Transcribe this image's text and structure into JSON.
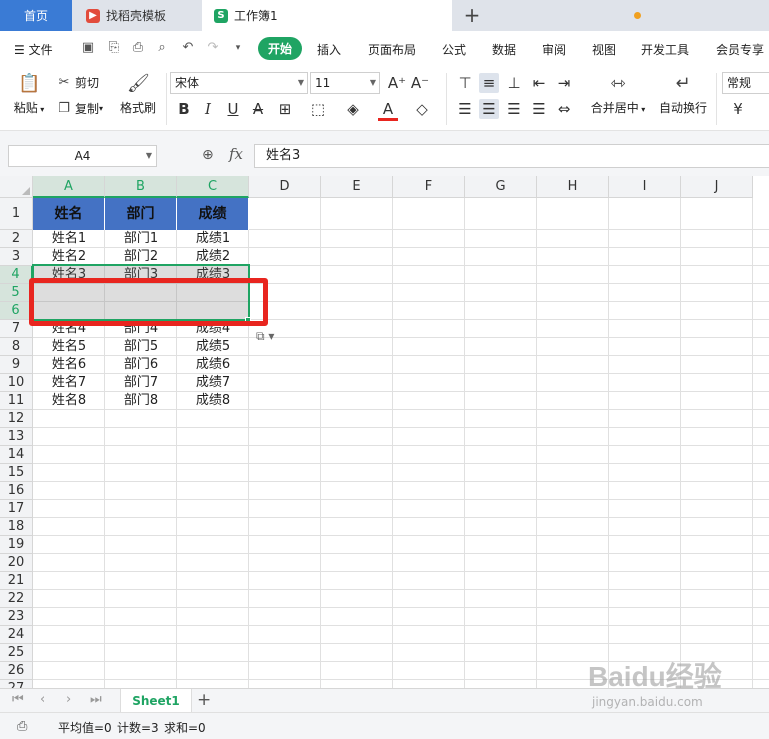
{
  "tabs": {
    "home": "首页",
    "template": "找稻壳模板",
    "workbook": "工作簿1"
  },
  "menu": {
    "file": "文件",
    "items": [
      "开始",
      "插入",
      "页面布局",
      "公式",
      "数据",
      "审阅",
      "视图",
      "开发工具",
      "会员专享"
    ]
  },
  "ribbon": {
    "paste": "粘贴",
    "cut": "剪切",
    "copy": "复制",
    "format_painter": "格式刷",
    "font_name": "宋体",
    "font_size": "11",
    "merge_center": "合并居中",
    "wrap_text": "自动换行",
    "number_format": "常规"
  },
  "formula_bar": {
    "cell_ref": "A4",
    "fx": "fx",
    "content": "姓名3"
  },
  "grid": {
    "columns": [
      "A",
      "B",
      "C",
      "D",
      "E",
      "F",
      "G",
      "H",
      "I",
      "J"
    ],
    "rows": [
      "1",
      "2",
      "3",
      "4",
      "5",
      "6",
      "7",
      "8",
      "9",
      "10",
      "11",
      "12",
      "13",
      "14",
      "15",
      "16",
      "17",
      "18",
      "19",
      "20",
      "21",
      "22",
      "23",
      "24",
      "25",
      "26",
      "27"
    ],
    "header_row": [
      "姓名",
      "部门",
      "成绩"
    ],
    "data": [
      [
        "姓名1",
        "部门1",
        "成绩1"
      ],
      [
        "姓名2",
        "部门2",
        "成绩2"
      ],
      [
        "姓名3",
        "部门3",
        "成绩3"
      ],
      [
        "",
        "",
        ""
      ],
      [
        "",
        "",
        ""
      ],
      [
        "姓名4",
        "部门4",
        "成绩4"
      ],
      [
        "姓名5",
        "部门5",
        "成绩5"
      ],
      [
        "姓名6",
        "部门6",
        "成绩6"
      ],
      [
        "姓名7",
        "部门7",
        "成绩7"
      ],
      [
        "姓名8",
        "部门8",
        "成绩8"
      ]
    ],
    "selected_rows": [
      "4",
      "5",
      "6"
    ],
    "selected_cols": [
      "A",
      "B",
      "C"
    ]
  },
  "sheet": {
    "name": "Sheet1"
  },
  "status": {
    "average": "平均值=0",
    "count": "计数=3",
    "sum": "求和=0"
  },
  "watermark": {
    "logo": "Baidu经验",
    "url": "jingyan.baidu.com"
  },
  "colors": {
    "accent": "#1fa463",
    "header_fill": "#4472c4",
    "highlight": "#e8251f",
    "home_tab": "#3a7bd5"
  }
}
